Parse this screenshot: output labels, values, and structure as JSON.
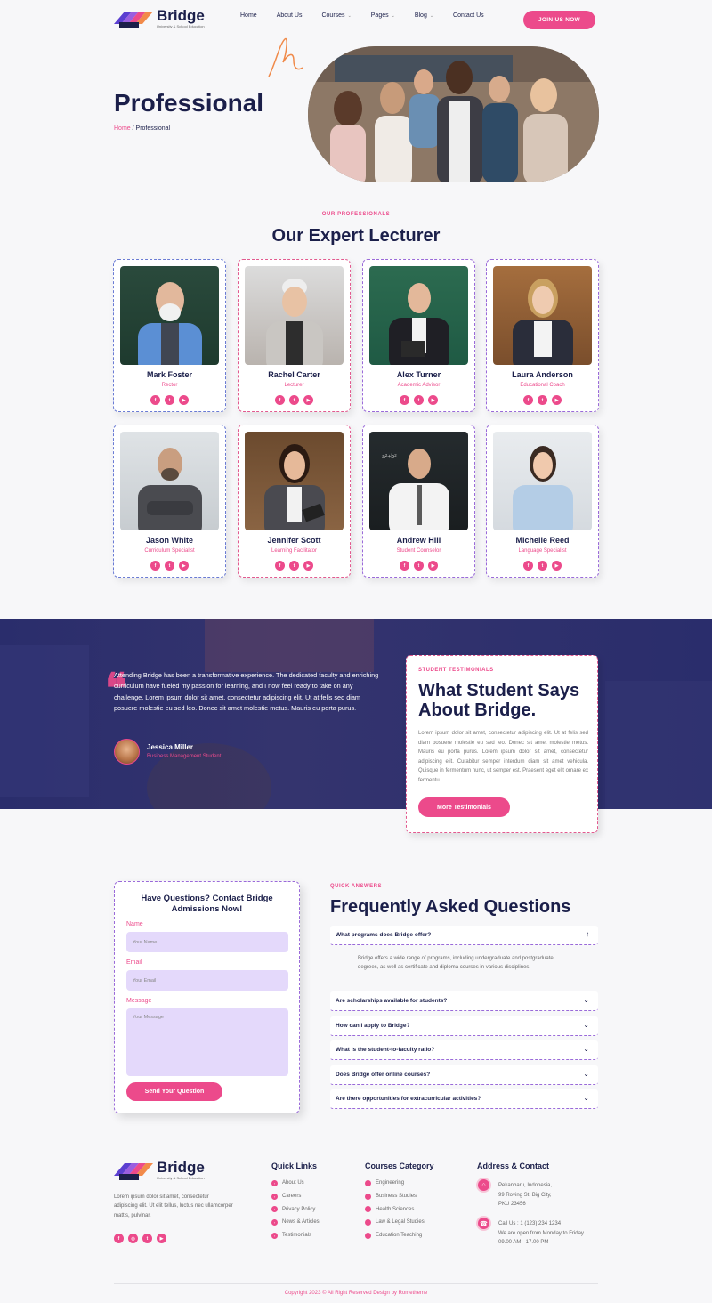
{
  "brand": {
    "name": "Bridge",
    "tagline": "University & School Education"
  },
  "nav": {
    "items": [
      {
        "label": "Home",
        "dropdown": false
      },
      {
        "label": "About Us",
        "dropdown": false
      },
      {
        "label": "Courses",
        "dropdown": true
      },
      {
        "label": "Pages",
        "dropdown": true
      },
      {
        "label": "Blog",
        "dropdown": true
      },
      {
        "label": "Contact Us",
        "dropdown": false
      }
    ],
    "cta": "JOIN US NOW"
  },
  "hero": {
    "title": "Professional",
    "breadcrumb_home": "Home",
    "breadcrumb_sep": " / ",
    "breadcrumb_current": "Professional"
  },
  "lecturers": {
    "eyebrow": "OUR PROFESSIONALS",
    "title": "Our Expert Lecturer",
    "cards": [
      {
        "name": "Mark Foster",
        "role": "Rector"
      },
      {
        "name": "Rachel Carter",
        "role": "Lecturer"
      },
      {
        "name": "Alex Turner",
        "role": "Academic Advisor"
      },
      {
        "name": "Laura Anderson",
        "role": "Educational Coach"
      },
      {
        "name": "Jason White",
        "role": "Curriculum Specialist"
      },
      {
        "name": "Jennifer Scott",
        "role": "Learning Facilitator"
      },
      {
        "name": "Andrew Hill",
        "role": "Student Counselor"
      },
      {
        "name": "Michelle Reed",
        "role": "Language Specialist"
      }
    ]
  },
  "testimonial": {
    "quote": "Attending Bridge has been a transformative experience. The dedicated faculty and enriching curriculum have fueled my passion for learning, and I now feel ready to take on any challenge. Lorem ipsum dolor sit amet, consectetur adipiscing elit. Ut at felis sed diam posuere molestie eu sed leo. Donec sit amet molestie metus. Mauris eu porta purus.",
    "name": "Jessica Miller",
    "role": "Business Management Student",
    "card_eyebrow": "STUDENT TESTIMONIALS",
    "card_title": "What Student Says About Bridge.",
    "card_body": "Lorem ipsum dolor sit amet, consectetur adipiscing elit. Ut at felis sed diam posuere molestie eu sed leo. Donec sit amet molestie metus. Mauris eu porta purus. Lorem ipsum dolor sit amet, consectetur adipiscing elit. Curabitur semper interdum diam sit amet vehicula. Quisque in fermentum nunc, ut semper est. Praesent eget elit ornare ex fermentu.",
    "card_button": "More Testimonials"
  },
  "contact": {
    "title": "Have Questions? Contact Bridge Admissions Now!",
    "name_label": "Name",
    "name_placeholder": "Your Name",
    "email_label": "Email",
    "email_placeholder": "Your Email",
    "message_label": "Message",
    "message_placeholder": "Your Message",
    "button": "Send Your Question"
  },
  "faq": {
    "eyebrow": "QUICK ANSWERS",
    "title": "Frequently Asked Questions",
    "items": [
      {
        "q": "What programs does Bridge offer?",
        "open": true
      },
      {
        "q": "Are scholarships available for students?",
        "open": false
      },
      {
        "q": "How can I apply to Bridge?",
        "open": false
      },
      {
        "q": "What is the student-to-faculty ratio?",
        "open": false
      },
      {
        "q": "Does Bridge offer online courses?",
        "open": false
      },
      {
        "q": "Are there opportunities for extracurricular activities?",
        "open": false
      }
    ],
    "open_answer": "Bridge offers a wide range of programs, including undergraduate and postgraduate degrees, as well as certificate and diploma courses in various disciplines."
  },
  "footer": {
    "about": "Lorem ipsum dolor sit amet, consectetur adipiscing elit. Ut elit tellus, luctus nec ullamcorper mattis, pulvinar.",
    "quick_links_title": "Quick Links",
    "quick_links": [
      "About Us",
      "Careers",
      "Privacy Policy",
      "News & Articles",
      "Testimonials"
    ],
    "courses_title": "Courses Category",
    "courses": [
      "Engineering",
      "Business Studies",
      "Health Sciences",
      "Law & Legal Studies",
      "Education Teaching"
    ],
    "address_title": "Address & Contact",
    "address_lines": [
      "Pekanbaru, Indonesia,",
      "99 Roving St, Big City,",
      "PKU 23456"
    ],
    "contact_lines": [
      "Call Us : 1 (123) 234 1234",
      "We are open from Monday to Friday",
      "09.00 AM - 17.00 PM"
    ],
    "copyright": "Copyright 2023 © All Right Reserved Design by Rometheme"
  },
  "colors": {
    "accent": "#ec4a8b",
    "navy": "#1b1f4a",
    "band": "#2a2d6c",
    "field": "#e4d9fb"
  }
}
